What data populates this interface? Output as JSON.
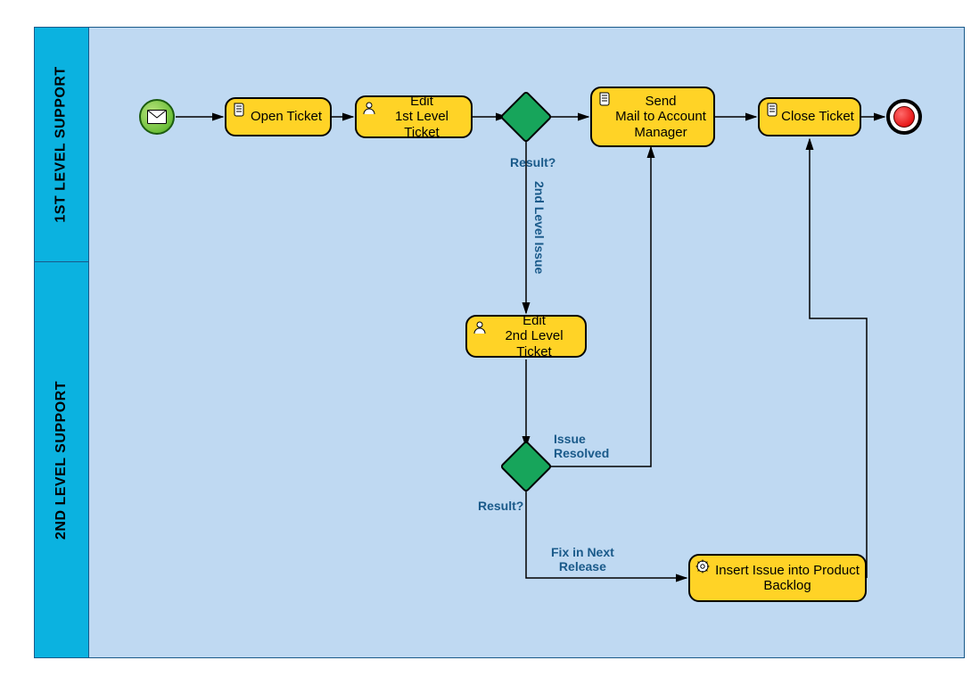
{
  "lanes": {
    "first": "1ST LEVEL SUPPORT",
    "second": "2ND LEVEL SUPPORT"
  },
  "tasks": {
    "open_ticket": "Open Ticket",
    "edit_1st": "Edit\n1st Level Ticket",
    "send_mail": "Send\nMail to Account\nManager",
    "close_ticket": "Close Ticket",
    "edit_2nd": "Edit\n2nd Level Ticket",
    "insert_backlog": "Insert Issue into Product Backlog"
  },
  "labels": {
    "gateway1": "Result?",
    "gateway2": "Result?",
    "second_level_issue": "2nd Level Issue",
    "issue_resolved": "Issue\nResolved",
    "fix_next_release": "Fix in Next\nRelease"
  }
}
